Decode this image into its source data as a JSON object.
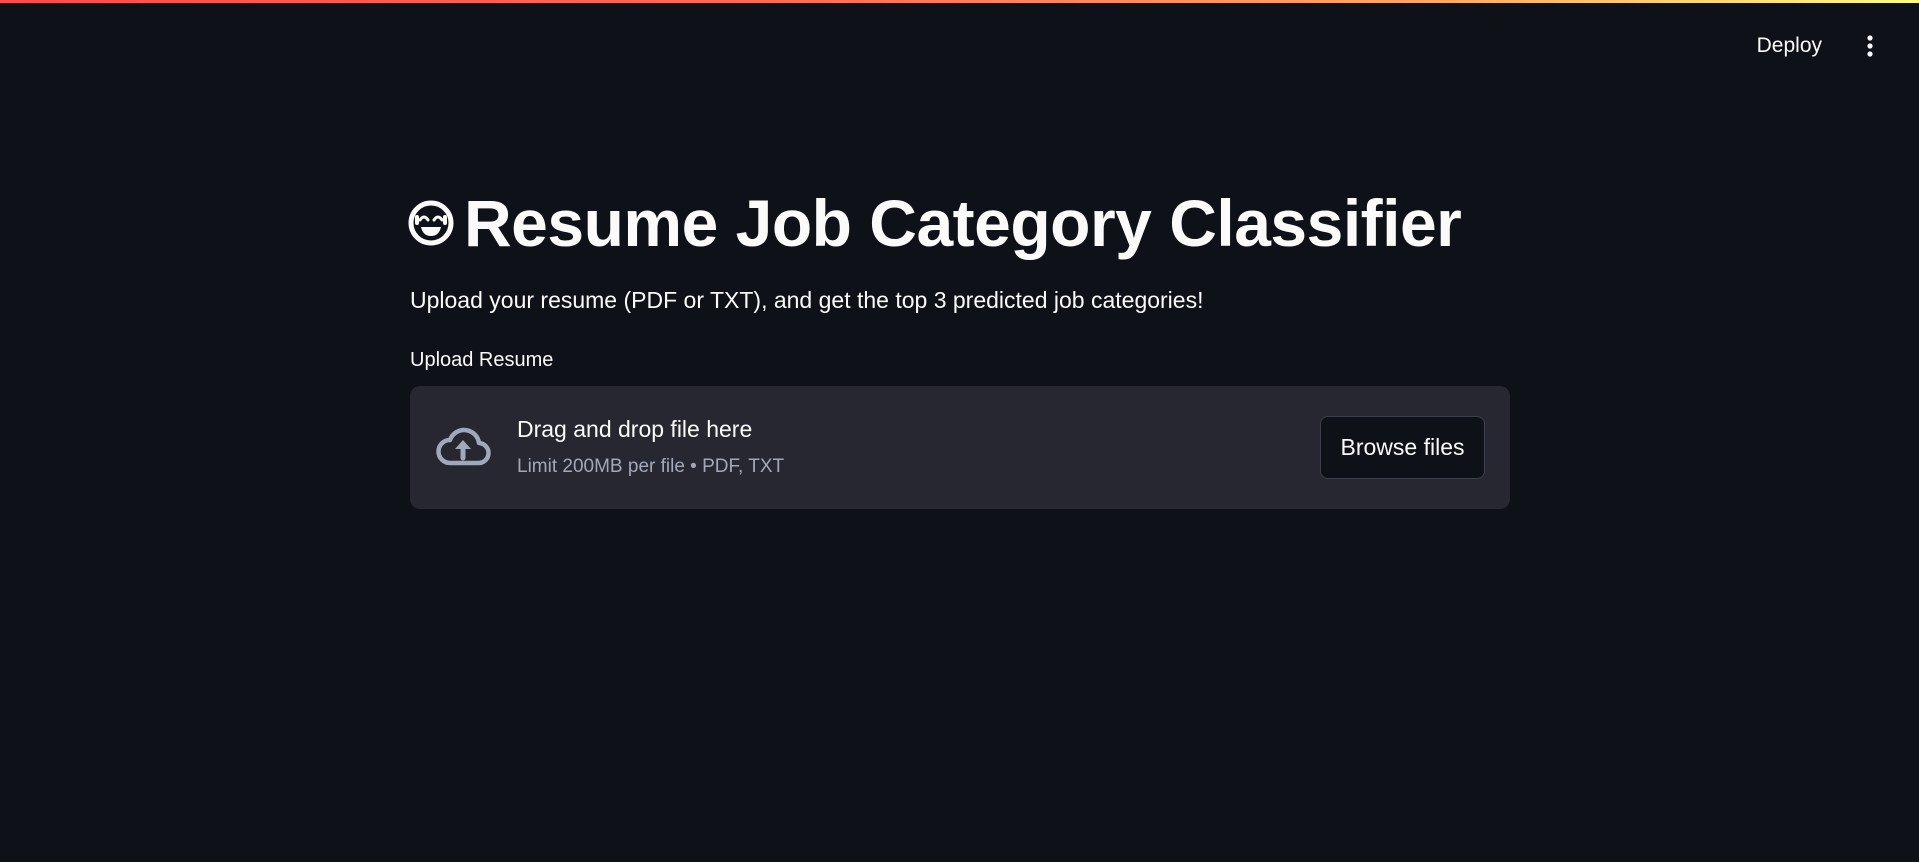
{
  "header": {
    "deploy_label": "Deploy",
    "menu_icon": "vertical-ellipsis-icon"
  },
  "main": {
    "title_icon": "smiling-face-icon",
    "title": "Resume Job Category Classifier",
    "subtitle": "Upload your resume (PDF or TXT), and get the top 3 predicted job categories!",
    "upload": {
      "label": "Upload Resume",
      "icon": "cloud-upload-icon",
      "drop_title": "Drag and drop file here",
      "drop_hint": "Limit 200MB per file • PDF, TXT",
      "browse_label": "Browse files"
    }
  },
  "colors": {
    "background": "#0e1117",
    "dropzone": "#262730",
    "text": "#fafafa",
    "muted_text": "#a3a8b8",
    "accent_gradient_start": "#ff4b4b",
    "accent_gradient_end": "#fffd80"
  }
}
